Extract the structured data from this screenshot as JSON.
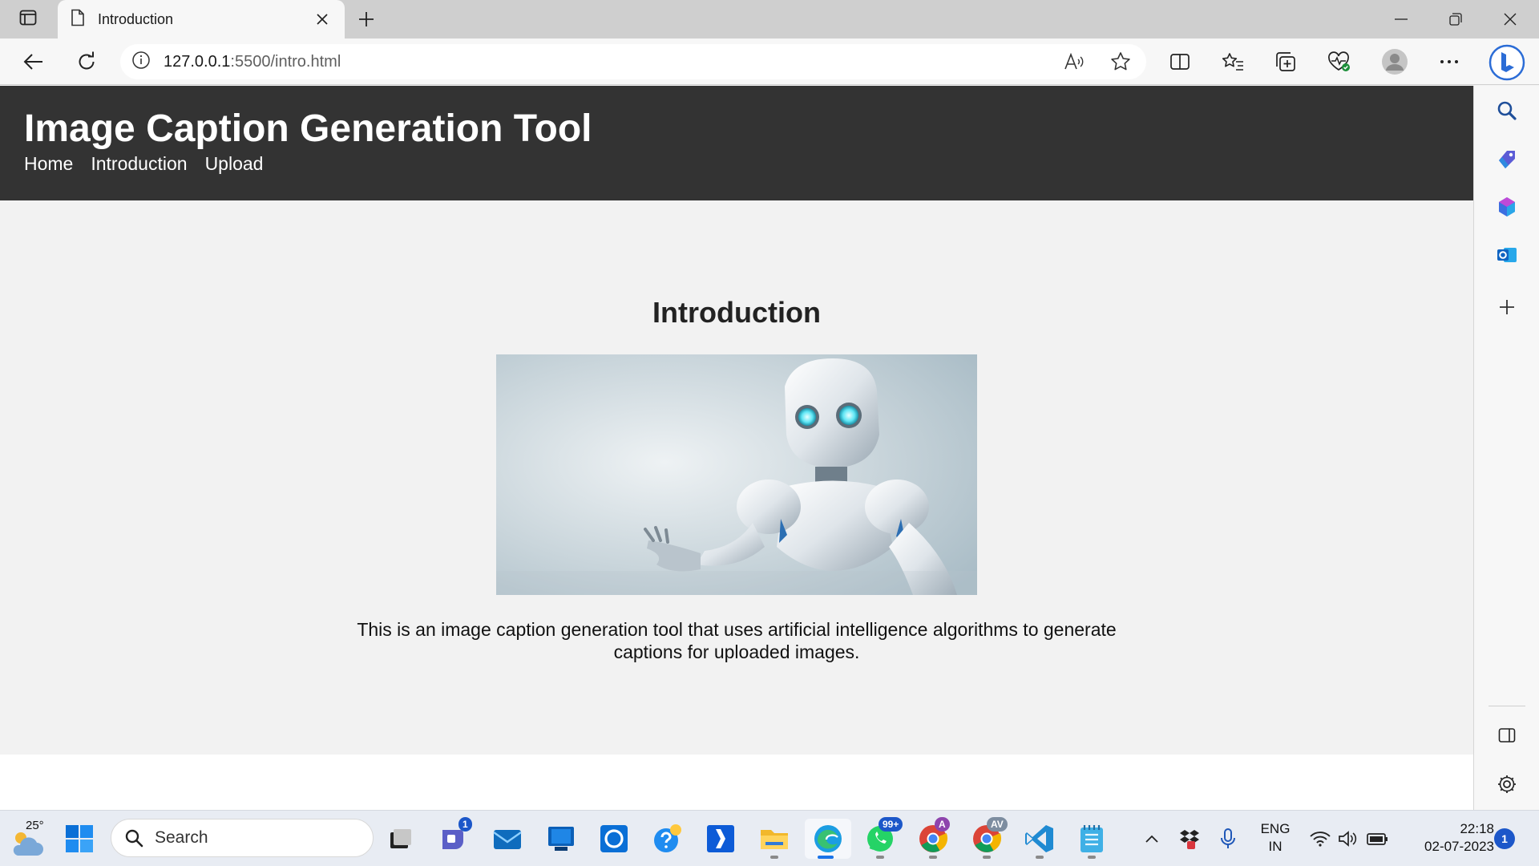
{
  "browser": {
    "tab_title": "Introduction",
    "url_host": "127.0.0.1",
    "url_path": ":5500/intro.html"
  },
  "page": {
    "site_title": "Image Caption Generation Tool",
    "nav": [
      "Home",
      "Introduction",
      "Upload"
    ],
    "heading": "Introduction",
    "description": "This is an image caption generation tool that uses artificial intelligence algorithms to generate captions for uploaded images."
  },
  "taskbar": {
    "temperature": "25°",
    "search_label": "Search",
    "badges": {
      "teams": "1",
      "whatsapp": "99+",
      "chrome1": "A",
      "chrome2": "AV"
    },
    "lang_line1": "ENG",
    "lang_line2": "IN",
    "time": "22:18",
    "date": "02-07-2023",
    "notification_count": "1"
  },
  "colors": {
    "header_bg": "#333333",
    "page_bg": "#f2f2f2",
    "accent": "#1a73e8"
  },
  "icons": [
    "tab-actions-icon",
    "page-icon",
    "close-icon",
    "plus-icon",
    "minimize-icon",
    "restore-icon",
    "back-icon",
    "refresh-icon",
    "info-icon",
    "read-aloud-icon",
    "favorite-star-icon",
    "split-screen-icon",
    "favorites-icon",
    "collections-icon",
    "browser-essentials-icon",
    "profile-icon",
    "more-icon",
    "bing-icon",
    "search-icon",
    "tools-icon",
    "office-icon",
    "outlook-icon",
    "add-icon",
    "sidebar-toggle-icon",
    "settings-icon",
    "weather-icon",
    "windows-start-icon",
    "task-view-icon",
    "teams-icon",
    "mail-icon",
    "store-icon",
    "cortana-icon",
    "help-icon",
    "app-icon",
    "file-explorer-icon",
    "edge-icon",
    "whatsapp-icon",
    "chrome-icon",
    "vscode-icon",
    "notepad-icon",
    "chevron-up-icon",
    "dropbox-icon",
    "microphone-icon",
    "wifi-icon",
    "volume-icon",
    "battery-icon"
  ]
}
